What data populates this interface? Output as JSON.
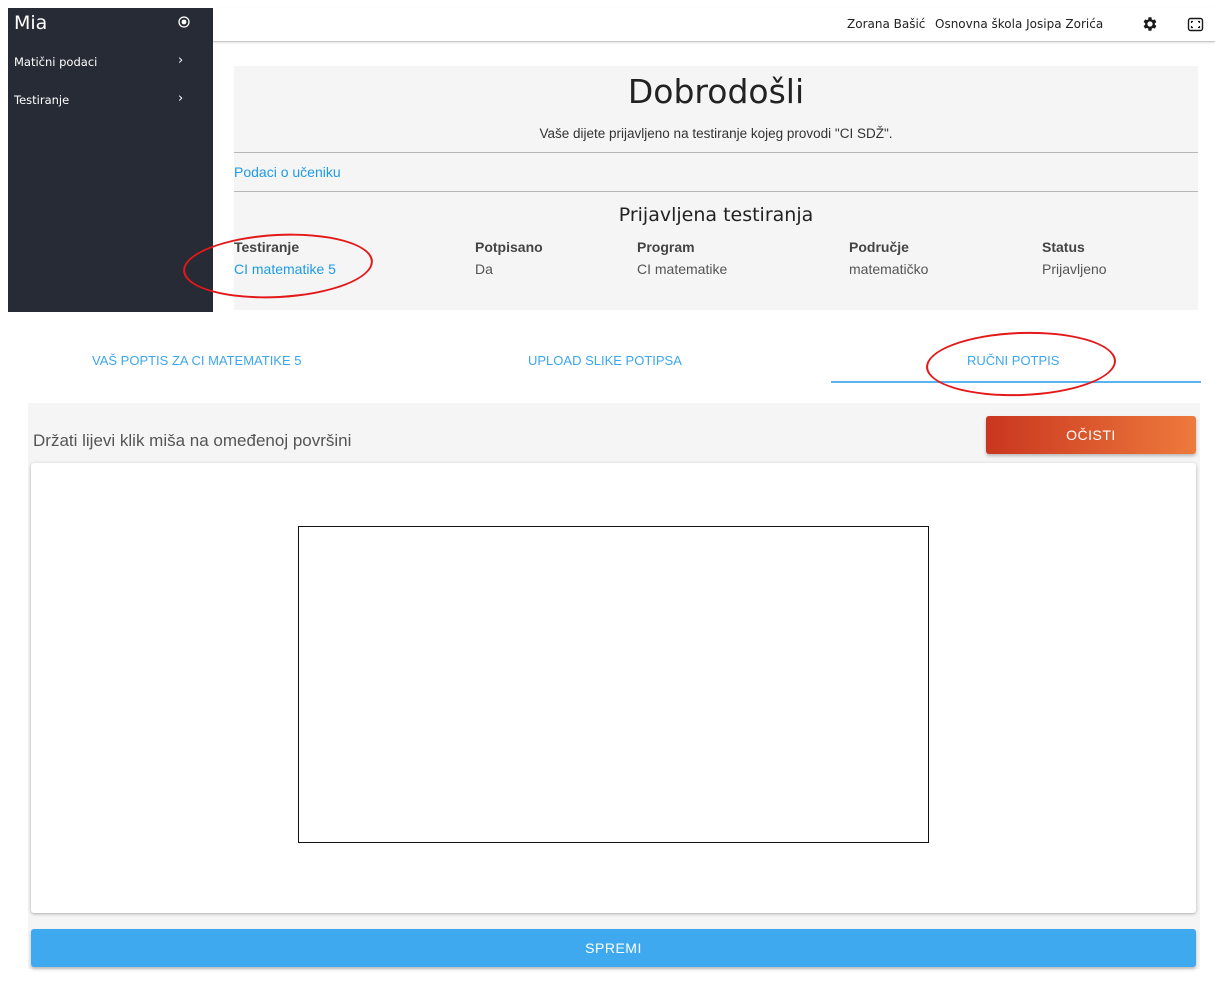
{
  "sidebar": {
    "brand": "Mia",
    "items": [
      {
        "label": "Matični podaci"
      },
      {
        "label": "Testiranje"
      }
    ]
  },
  "topbar": {
    "user": "Zorana Bašić",
    "school": "Osnovna škola Josipa Zorića",
    "icons": [
      "gear-icon",
      "fullscreen-icon"
    ]
  },
  "welcome": {
    "title": "Dobrodošli",
    "subtitle": "Vaše dijete prijavljeno na testiranje kojeg provodi \"CI SDŽ\".",
    "student_link": "Podaci o učeniku"
  },
  "registered": {
    "title": "Prijavljena testiranja",
    "columns": [
      "Testiranje",
      "Potpisano",
      "Program",
      "Područje",
      "Status"
    ],
    "rows": [
      [
        "CI matematike 5",
        "Da",
        "CI matematike",
        "matematičko",
        "Prijavljeno"
      ]
    ]
  },
  "tabs": [
    {
      "label": "VAŠ POPTIS ZA CI MATEMATIKE 5"
    },
    {
      "label": "UPLOAD SLIKE POTIPSA"
    },
    {
      "label": "RUČNI POTPIS",
      "active": true
    }
  ],
  "signature": {
    "instruction": "Držati lijevi klik miša na omeđenoj površini",
    "clear_label": "OČISTI",
    "save_label": "SPREMI"
  },
  "colors": {
    "sidebar_bg": "#272b35",
    "link": "#1e9be6",
    "save_button": "#3ea9ef",
    "clear_gradient_start": "#c9361f",
    "clear_gradient_end": "#ee7a3c",
    "annotation": "#e31919"
  }
}
